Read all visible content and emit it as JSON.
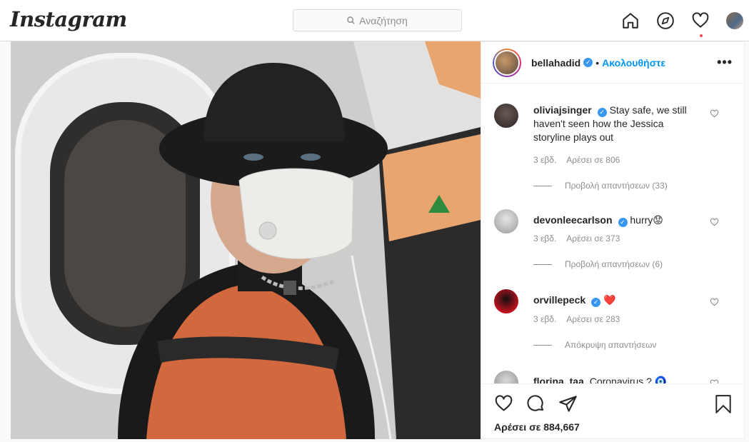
{
  "topbar": {
    "logo": "Instagram",
    "search_placeholder": "Αναζήτηση",
    "icons": [
      "home-icon",
      "explore-icon",
      "activity-heart-icon",
      "profile-avatar"
    ]
  },
  "post": {
    "author": "bellahadid",
    "follow_label": "Ακολουθήστε",
    "separator": "•",
    "more_label": "•••",
    "likes": "Αρέσει σε 884,667"
  },
  "comments": [
    {
      "user": "oliviajsinger",
      "verified": true,
      "text": "Stay safe, we still haven't seen how the Jessica storyline plays out",
      "age": "3 εβδ.",
      "likes": "Αρέσει σε 806",
      "replies": "Προβολή απαντήσεων (33)"
    },
    {
      "user": "devonleecarlson",
      "verified": true,
      "text": "hurry😟",
      "age": "3 εβδ.",
      "likes": "Αρέσει σε 373",
      "replies": "Προβολή απαντήσεων (6)"
    },
    {
      "user": "orvillepeck",
      "verified": true,
      "text": "❤️",
      "age": "3 εβδ.",
      "likes": "Αρέσει σε 283",
      "replies": "Απόκρυψη απαντήσεων"
    },
    {
      "user": "florina_taa",
      "verified": false,
      "text": "Coronavirus ? 🧿",
      "age": "",
      "likes": "",
      "replies": ""
    }
  ],
  "colors": {
    "accent": "#0095f6",
    "verified": "#3897f0",
    "notification": "#ed4956",
    "border": "#dbdbdb"
  }
}
